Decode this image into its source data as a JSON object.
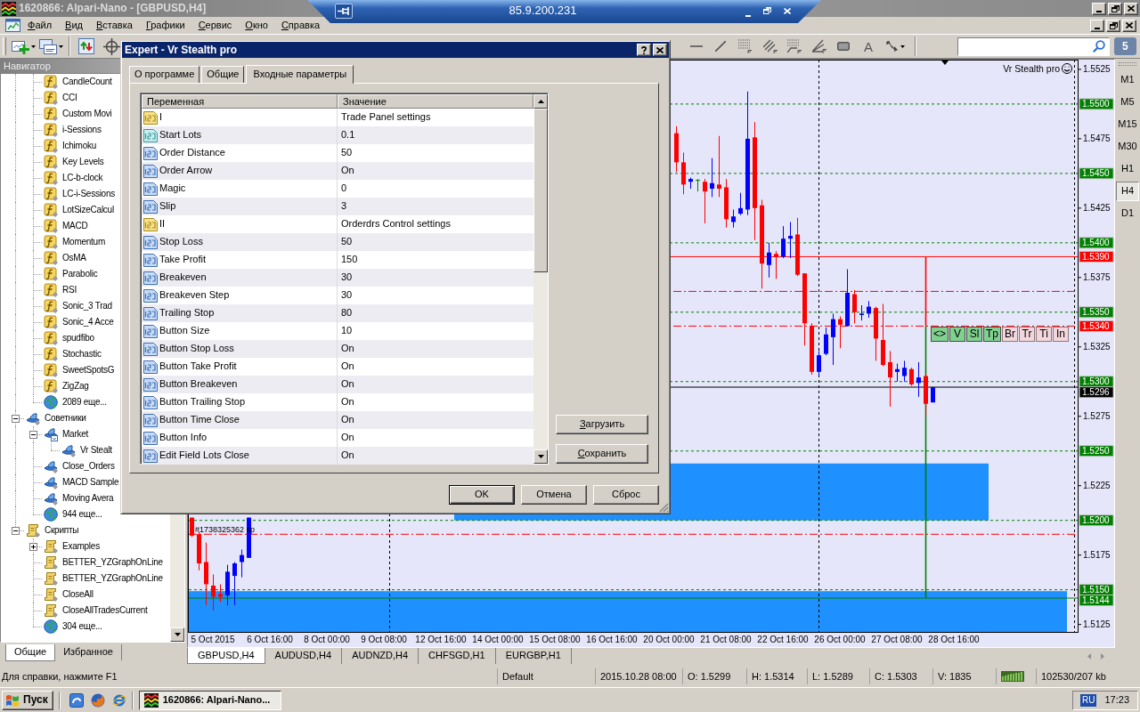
{
  "window": {
    "title": "1620866: Alpari-Nano - [GBPUSD,H4]"
  },
  "remote_bar": {
    "host": "85.9.200.231"
  },
  "menu": [
    "Файл",
    "Вид",
    "Вставка",
    "Графики",
    "Сервис",
    "Окно",
    "Справка"
  ],
  "toolbar": {
    "text_tool": "A",
    "messages": "5"
  },
  "navigator": {
    "title": "Навигатор",
    "tree": [
      {
        "children": [
          {
            "kind": "indicator",
            "label": "CandleCount"
          },
          {
            "kind": "indicator",
            "label": "CCI"
          },
          {
            "kind": "indicator",
            "label": "Custom Movi"
          },
          {
            "kind": "indicator",
            "label": "i-Sessions"
          },
          {
            "kind": "indicator",
            "label": "Ichimoku"
          },
          {
            "kind": "indicator",
            "label": "Key Levels"
          },
          {
            "kind": "indicator",
            "label": "LC-b-clock"
          },
          {
            "kind": "indicator",
            "label": "LC-i-Sessions"
          },
          {
            "kind": "indicator",
            "label": "LotSizeCalcul"
          },
          {
            "kind": "indicator",
            "label": "MACD"
          },
          {
            "kind": "indicator",
            "label": "Momentum"
          },
          {
            "kind": "indicator",
            "label": "OsMA"
          },
          {
            "kind": "indicator",
            "label": "Parabolic"
          },
          {
            "kind": "indicator",
            "label": "RSI"
          },
          {
            "kind": "indicator",
            "label": "Sonic_3 Trad"
          },
          {
            "kind": "indicator",
            "label": "Sonic_4 Acce"
          },
          {
            "kind": "indicator",
            "label": "spudfibo"
          },
          {
            "kind": "indicator",
            "label": "Stochastic"
          },
          {
            "kind": "indicator",
            "label": "SweetSpotsG"
          },
          {
            "kind": "indicator",
            "label": "ZigZag"
          },
          {
            "kind": "more",
            "label": "2089 еще..."
          }
        ]
      },
      {
        "kind": "expert",
        "label": "Советники",
        "expanded": true,
        "children": [
          {
            "kind": "market",
            "label": "Market",
            "expanded": true,
            "children": [
              {
                "kind": "expert",
                "label": "Vr Stealt"
              }
            ]
          },
          {
            "kind": "expert",
            "label": "Close_Orders"
          },
          {
            "kind": "expert",
            "label": "MACD Sample"
          },
          {
            "kind": "expert",
            "label": "Moving Avera"
          },
          {
            "kind": "more",
            "label": "944 еще..."
          }
        ]
      },
      {
        "kind": "script",
        "label": "Скрипты",
        "expanded": true,
        "children": [
          {
            "kind": "script",
            "label": "Examples",
            "expanded": false
          },
          {
            "kind": "script",
            "label": "BETTER_YZGraphOnLine"
          },
          {
            "kind": "script",
            "label": "BETTER_YZGraphOnLine"
          },
          {
            "kind": "script",
            "label": "CloseAll"
          },
          {
            "kind": "script",
            "label": "CloseAllTradesCurrent"
          },
          {
            "kind": "more",
            "label": "304 еще..."
          }
        ]
      }
    ],
    "tabs": [
      {
        "label": "Общие",
        "selected": true
      },
      {
        "label": "Избранное",
        "selected": false
      }
    ]
  },
  "chart": {
    "ea_label": "Vr Stealth pro",
    "panel_buttons": [
      {
        "label": "<>",
        "on": true
      },
      {
        "label": "V",
        "on": true
      },
      {
        "label": "Sl",
        "on": true
      },
      {
        "label": "Tp",
        "on": true
      },
      {
        "label": "Br",
        "on": false
      },
      {
        "label": "Tr",
        "on": false
      },
      {
        "label": "Ti",
        "on": false
      },
      {
        "label": "In",
        "on": false
      }
    ],
    "chart_data": [
      {
        "type": "candlestick",
        "ylim": [
          1.5119,
          1.5532
        ],
        "categories": [
          null,
          null,
          null,
          "5 Oct 2015",
          null,
          null,
          null,
          null,
          null,
          null,
          null,
          "6 Oct 16:00",
          null,
          null,
          null,
          null,
          null,
          null,
          null,
          "8 Oct 00:00",
          null,
          null,
          null,
          null,
          null,
          null,
          null,
          "9 Oct 08:00",
          null,
          null,
          null,
          null,
          null,
          null,
          null,
          "12 Oct 16:00",
          null,
          null,
          null,
          null,
          null,
          null,
          null,
          "14 Oct 00:00",
          null,
          null,
          null,
          null,
          null,
          null,
          null,
          "15 Oct 08:00",
          null,
          null,
          null,
          null,
          null,
          null,
          null,
          "16 Oct 16:00",
          null,
          null,
          null,
          null,
          null,
          null,
          null,
          "20 Oct 00:00",
          null,
          null,
          null,
          null,
          null,
          null,
          null,
          "21 Oct 08:00",
          null,
          null,
          null,
          null,
          null,
          null,
          null,
          "22 Oct 16:00",
          null,
          null,
          null,
          null,
          null,
          null,
          null,
          "26 Oct 00:00",
          null,
          null,
          null,
          null,
          null,
          null,
          null,
          "27 Oct 08:00",
          null,
          null,
          null,
          null,
          null,
          null,
          null,
          "28 Oct 16:00",
          null,
          null,
          null,
          null,
          null,
          null,
          null,
          null,
          null,
          null,
          null,
          null,
          null,
          null,
          null,
          null,
          null
        ],
        "ohlc": [
          [
            1.5202,
            1.5202,
            1.5188,
            1.5189
          ],
          [
            1.519,
            1.5192,
            1.5164,
            1.5169
          ],
          [
            1.517,
            1.5184,
            1.5139,
            1.5154
          ],
          [
            1.5153,
            1.5161,
            1.5135,
            1.5145
          ],
          [
            1.5147,
            1.5154,
            1.5141,
            1.5145
          ],
          [
            1.5146,
            1.5168,
            1.5139,
            1.5163
          ],
          [
            1.516,
            1.517,
            1.5139,
            1.5169
          ],
          [
            1.517,
            1.5179,
            1.5159,
            1.5175
          ],
          [
            1.5173,
            1.5202,
            1.5173,
            1.5202
          ],
          null,
          null,
          null,
          null,
          null,
          null,
          null,
          null,
          null,
          null,
          null,
          null,
          null,
          null,
          null,
          null,
          null,
          null,
          null,
          null,
          null,
          null,
          null,
          null,
          null,
          null,
          null,
          null,
          null,
          null,
          null,
          null,
          null,
          null,
          null,
          null,
          null,
          null,
          null,
          null,
          null,
          null,
          null,
          null,
          null,
          null,
          null,
          null,
          null,
          null,
          null,
          null,
          null,
          null,
          null,
          null,
          null,
          null,
          null,
          [
            1.5479,
            1.5484,
            1.5451,
            1.5458
          ],
          [
            1.5458,
            1.5465,
            1.5435,
            1.5442
          ],
          [
            1.5444,
            1.5447,
            1.5439,
            1.5446
          ],
          [
            1.5445,
            1.5446,
            1.5437,
            1.5445
          ],
          [
            1.5444,
            1.5446,
            1.5414,
            1.5437
          ],
          [
            1.5439,
            1.5461,
            1.5433,
            1.5443
          ],
          [
            1.5442,
            1.5477,
            1.5433,
            1.5439
          ],
          [
            1.544,
            1.5446,
            1.5411,
            1.5417
          ],
          [
            1.5415,
            1.5424,
            1.5411,
            1.5419
          ],
          [
            1.5421,
            1.5436,
            1.542,
            1.5425
          ],
          [
            1.5424,
            1.5509,
            1.542,
            1.5475
          ],
          [
            1.5476,
            1.5487,
            1.5402,
            1.5425
          ],
          [
            1.5427,
            1.5431,
            1.5367,
            1.5385
          ],
          [
            1.5384,
            1.54,
            1.5375,
            1.5393
          ],
          [
            1.5392,
            1.5394,
            1.5374,
            1.539
          ],
          [
            1.539,
            1.5412,
            1.5389,
            1.5403
          ],
          [
            1.5403,
            1.5415,
            1.5389,
            1.5405
          ],
          [
            1.5406,
            1.5418,
            1.5376,
            1.5377
          ],
          [
            1.5378,
            1.5378,
            1.5326,
            1.5342
          ],
          [
            1.534,
            1.5342,
            1.5305,
            1.5307
          ],
          [
            1.5307,
            1.5322,
            1.5305,
            1.5319
          ],
          [
            1.532,
            1.5339,
            1.5319,
            1.5334
          ],
          [
            1.5332,
            1.5349,
            1.5312,
            1.5345
          ],
          [
            1.5345,
            1.5347,
            1.5324,
            1.5341
          ],
          [
            1.534,
            1.5381,
            1.534,
            1.5364
          ],
          [
            1.5363,
            1.5366,
            1.5342,
            1.535
          ],
          [
            1.5348,
            1.5355,
            1.5344,
            1.5349
          ],
          [
            1.5349,
            1.5358,
            1.5346,
            1.5354
          ],
          [
            1.5353,
            1.5354,
            1.5315,
            1.5331
          ],
          [
            1.533,
            1.5356,
            1.5311,
            1.5312
          ],
          [
            1.5314,
            1.5322,
            1.5282,
            1.5303
          ],
          [
            1.5307,
            1.5313,
            1.53,
            1.5309
          ],
          [
            1.5304,
            1.5315,
            1.53,
            1.531
          ],
          [
            1.5309,
            1.531,
            1.5297,
            1.5298
          ],
          [
            1.5299,
            1.5314,
            1.5289,
            1.5303
          ],
          [
            1.5304,
            1.5306,
            1.5275,
            1.5284
          ],
          [
            1.5285,
            1.5296,
            1.5285,
            1.5296
          ],
          null,
          null,
          null,
          null,
          null,
          null,
          null,
          null,
          null,
          null,
          null,
          null,
          null,
          null,
          null,
          null,
          null,
          null,
          null,
          null
        ],
        "yticks": [
          1.5125,
          1.5175,
          1.5225,
          1.5275,
          1.5325,
          1.5375,
          1.5425,
          1.5475,
          1.5525
        ],
        "ref_lines": [
          {
            "axis": "y",
            "value": 1.55,
            "label": "1.5500",
            "color": "#008000",
            "line_style": "dotted"
          },
          {
            "axis": "y",
            "value": 1.545,
            "label": "1.5450",
            "color": "#008000",
            "line_style": "dotted"
          },
          {
            "axis": "y",
            "value": 1.54,
            "label": "1.5400",
            "color": "#008000",
            "line_style": "dotted"
          },
          {
            "axis": "y",
            "value": 1.539,
            "label": "1.5390",
            "color": "#ff0000",
            "line_style": "solid"
          },
          {
            "axis": "y",
            "value": 1.5365,
            "color": "#ff0000",
            "line_style": "dashdot"
          },
          {
            "axis": "y",
            "value": 1.535,
            "label": "1.5350",
            "color": "#008000",
            "line_style": "dotted"
          },
          {
            "axis": "y",
            "value": 1.534,
            "label": "1.5340",
            "color": "#ff0000",
            "line_style": "dashdot"
          },
          {
            "axis": "y",
            "value": 1.53,
            "label": "1.5300",
            "color": "#008000",
            "line_style": "dotted"
          },
          {
            "axis": "y",
            "value": 1.5296,
            "label": "1.5296",
            "color": "#000000",
            "line_style": "solid"
          },
          {
            "axis": "y",
            "value": 1.525,
            "label": "1.5250",
            "color": "#008000",
            "line_style": "dotted"
          },
          {
            "axis": "y",
            "value": 1.52,
            "label": "1.5200",
            "color": "#008000",
            "line_style": "dotted"
          },
          {
            "axis": "y",
            "value": 1.519,
            "color": "#ff0000",
            "line_style": "dashdot"
          },
          {
            "axis": "y",
            "value": 1.515,
            "label": "1.5150",
            "color": "#008000",
            "line_style": "dotted"
          },
          {
            "axis": "y",
            "value": 1.5144,
            "label": "1.5144",
            "color": "#008000",
            "line_style": "solid"
          }
        ],
        "annotations": [
          "#1738325362 sp"
        ]
      }
    ]
  },
  "timeframes": [
    {
      "label": "M1",
      "selected": false
    },
    {
      "label": "M5",
      "selected": false
    },
    {
      "label": "M15",
      "selected": false
    },
    {
      "label": "M30",
      "selected": false
    },
    {
      "label": "H1",
      "selected": false
    },
    {
      "label": "H4",
      "selected": true
    },
    {
      "label": "D1",
      "selected": false
    }
  ],
  "chart_tabs": [
    {
      "label": "GBPUSD,H4",
      "selected": true
    },
    {
      "label": "AUDUSD,H4",
      "selected": false
    },
    {
      "label": "AUDNZD,H4",
      "selected": false
    },
    {
      "label": "CHFSGD,H1",
      "selected": false
    },
    {
      "label": "EURGBP,H1",
      "selected": false
    }
  ],
  "dialog": {
    "title": "Expert - Vr Stealth pro",
    "tabs": [
      {
        "label": "О программе",
        "selected": false
      },
      {
        "label": "Общие",
        "selected": false
      },
      {
        "label": "Входные параметры",
        "selected": true
      }
    ],
    "columns": [
      "Переменная",
      "Значение"
    ],
    "rows": [
      {
        "kind": "string",
        "name": "I",
        "value": "Trade Panel settings"
      },
      {
        "kind": "double",
        "name": "Start Lots",
        "value": "0.1"
      },
      {
        "kind": "int",
        "name": "Order Distance",
        "value": "50"
      },
      {
        "kind": "int",
        "name": "Order Arrow",
        "value": "On"
      },
      {
        "kind": "int",
        "name": "Magic",
        "value": "0"
      },
      {
        "kind": "int",
        "name": "Slip",
        "value": "3"
      },
      {
        "kind": "string",
        "name": "II",
        "value": "Orderdrs Control settings"
      },
      {
        "kind": "int",
        "name": "Stop Loss",
        "value": "50"
      },
      {
        "kind": "int",
        "name": "Take Profit",
        "value": "150"
      },
      {
        "kind": "int",
        "name": "Breakeven",
        "value": "30"
      },
      {
        "kind": "int",
        "name": "Breakeven Step",
        "value": "30"
      },
      {
        "kind": "int",
        "name": "Trailing Stop",
        "value": "80"
      },
      {
        "kind": "int",
        "name": "Button Size",
        "value": "10"
      },
      {
        "kind": "int",
        "name": "Button Stop Loss",
        "value": "On"
      },
      {
        "kind": "int",
        "name": "Button Take Profit",
        "value": "On"
      },
      {
        "kind": "int",
        "name": "Button Breakeven",
        "value": "On"
      },
      {
        "kind": "int",
        "name": "Button Trailing Stop",
        "value": "On"
      },
      {
        "kind": "int",
        "name": "Button Time Close",
        "value": "On"
      },
      {
        "kind": "int",
        "name": "Button Info",
        "value": "On"
      },
      {
        "kind": "int",
        "name": "Edit Field Lots Close",
        "value": "On"
      }
    ],
    "side_buttons": [
      "Загрузить",
      "Сохранить"
    ],
    "buttons": [
      {
        "label": "OK",
        "default": true
      },
      {
        "label": "Отмена",
        "default": false
      },
      {
        "label": "Сброс",
        "default": false
      }
    ]
  },
  "status_bar": {
    "help": "Для справки, нажмите F1",
    "profile": "Default",
    "bar_time": "2015.10.28 08:00",
    "open": "O: 1.5299",
    "high": "H: 1.5314",
    "low": "L: 1.5289",
    "close": "C: 1.5303",
    "volume": "V: 1835",
    "traffic": "102530/207 kb"
  },
  "taskbar": {
    "start": "Пуск",
    "task": "1620866: Alpari-Nano...",
    "language": "RU",
    "clock": "17:23"
  }
}
